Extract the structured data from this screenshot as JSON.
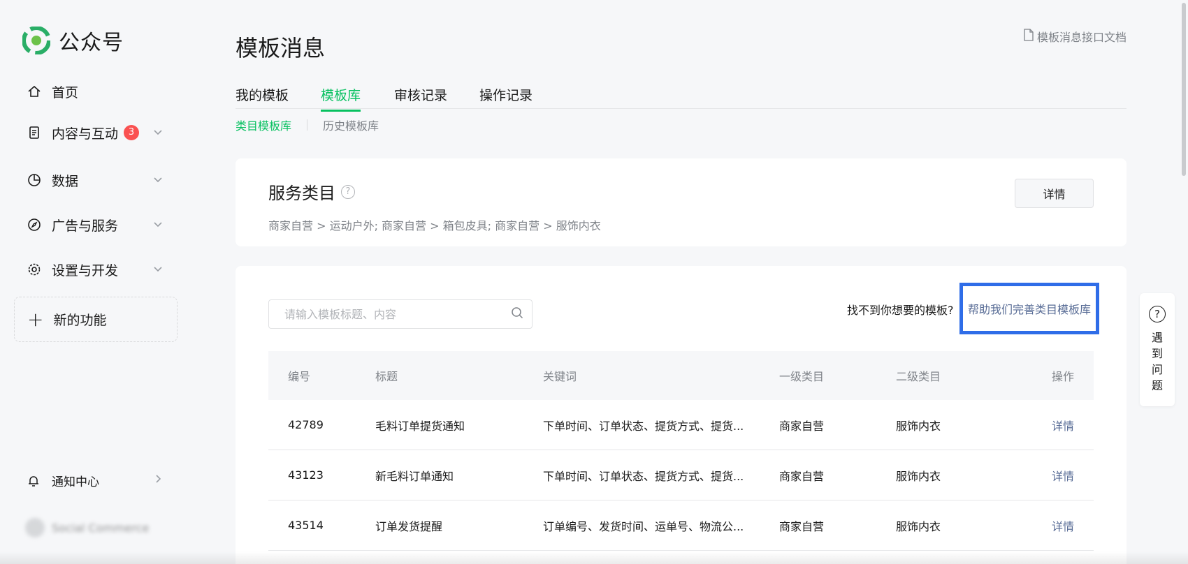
{
  "app": {
    "name": "公众号"
  },
  "sidebar": {
    "items": [
      {
        "label": "首页",
        "icon": "home-icon"
      },
      {
        "label": "内容与互动",
        "icon": "document-icon",
        "badge": "3"
      },
      {
        "label": "数据",
        "icon": "pie-chart-icon"
      },
      {
        "label": "广告与服务",
        "icon": "compass-icon"
      },
      {
        "label": "设置与开发",
        "icon": "gear-icon"
      }
    ],
    "new_feature": "新的功能",
    "notify": "通知中心",
    "account_name": "Social Commerce"
  },
  "page": {
    "title": "模板消息",
    "doc_link": "模板消息接口文档"
  },
  "tabs": [
    {
      "label": "我的模板"
    },
    {
      "label": "模板库"
    },
    {
      "label": "审核记录"
    },
    {
      "label": "操作记录"
    }
  ],
  "subtabs": [
    {
      "label": "类目模板库"
    },
    {
      "label": "历史模板库"
    }
  ],
  "service": {
    "title": "服务类目",
    "path": "商家自营 > 运动户外; 商家自营 > 箱包皮具; 商家自营 > 服饰内衣",
    "detail_button": "详情"
  },
  "search": {
    "placeholder": "请输入模板标题、内容"
  },
  "help": {
    "text": "找不到你想要的模板?",
    "link": "帮助我们完善类目模板库"
  },
  "table": {
    "headers": [
      "编号",
      "标题",
      "关键词",
      "一级类目",
      "二级类目",
      "操作"
    ],
    "rows": [
      {
        "id": "42789",
        "title": "毛料订单提货通知",
        "keywords": "下单时间、订单状态、提货方式、提货...",
        "cat1": "商家自营",
        "cat2": "服饰内衣",
        "action": "详情"
      },
      {
        "id": "43123",
        "title": "新毛料订单通知",
        "keywords": "下单时间、订单状态、提货方式、提货...",
        "cat1": "商家自营",
        "cat2": "服饰内衣",
        "action": "详情"
      },
      {
        "id": "43514",
        "title": "订单发货提醒",
        "keywords": "订单编号、发货时间、运单号、物流公...",
        "cat1": "商家自营",
        "cat2": "服饰内衣",
        "action": "详情"
      }
    ]
  },
  "float_help": {
    "label": "遇到问题"
  },
  "colors": {
    "brand": "#07c160",
    "link": "#576b95",
    "badge": "#fa5151",
    "highlight": "#2f6de8"
  }
}
